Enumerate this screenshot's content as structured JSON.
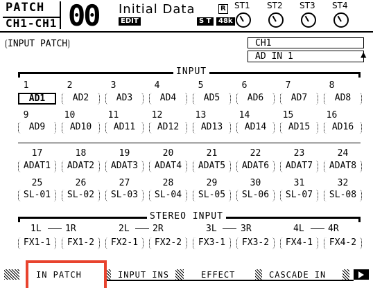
{
  "header": {
    "patch_title": "PATCH",
    "channel_title": "CH1-CH1",
    "scene_number": "00",
    "scene_title": "Initial Data",
    "edit_badge": "EDIT",
    "r_badge": "R",
    "st_badge": "S T",
    "rate_badge": "48k",
    "st_knobs": [
      "ST1",
      "ST2",
      "ST3",
      "ST4"
    ]
  },
  "page": {
    "page_label": "INPUT PATCH",
    "channel_name": "CH1",
    "source_name": "AD IN 1"
  },
  "input_section": {
    "label": "INPUT",
    "row1_numbers": [
      "1",
      "2",
      "3",
      "4",
      "5",
      "6",
      "7",
      "8"
    ],
    "row1_buttons": [
      "AD1",
      "AD2",
      "AD3",
      "AD4",
      "AD5",
      "AD6",
      "AD7",
      "AD8"
    ],
    "row2_numbers": [
      "9",
      "10",
      "11",
      "12",
      "13",
      "14",
      "15",
      "16"
    ],
    "row2_buttons": [
      "AD9",
      "AD10",
      "AD11",
      "AD12",
      "AD13",
      "AD14",
      "AD15",
      "AD16"
    ],
    "row3_numbers": [
      "17",
      "18",
      "19",
      "20",
      "21",
      "22",
      "23",
      "24"
    ],
    "row3_buttons": [
      "ADAT1",
      "ADAT2",
      "ADAT3",
      "ADAT4",
      "ADAT5",
      "ADAT6",
      "ADAT7",
      "ADAT8"
    ],
    "row4_numbers": [
      "25",
      "26",
      "27",
      "28",
      "29",
      "30",
      "31",
      "32"
    ],
    "row4_buttons": [
      "SL-01",
      "SL-02",
      "SL-03",
      "SL-04",
      "SL-05",
      "SL-06",
      "SL-07",
      "SL-08"
    ]
  },
  "stereo_section": {
    "label": "STEREO INPUT",
    "pairs": [
      [
        "1L",
        "1R"
      ],
      [
        "2L",
        "2R"
      ],
      [
        "3L",
        "3R"
      ],
      [
        "4L",
        "4R"
      ]
    ],
    "buttons": [
      "FX1-1",
      "FX1-2",
      "FX2-1",
      "FX2-2",
      "FX3-1",
      "FX3-2",
      "FX4-1",
      "FX4-2"
    ]
  },
  "tabs": [
    "IN PATCH",
    "INPUT INS",
    "EFFECT",
    "CASCADE IN"
  ],
  "colors": {
    "highlight": "#e8432e",
    "foreground": "#000000",
    "background": "#ffffff"
  },
  "selected_button": "AD1"
}
